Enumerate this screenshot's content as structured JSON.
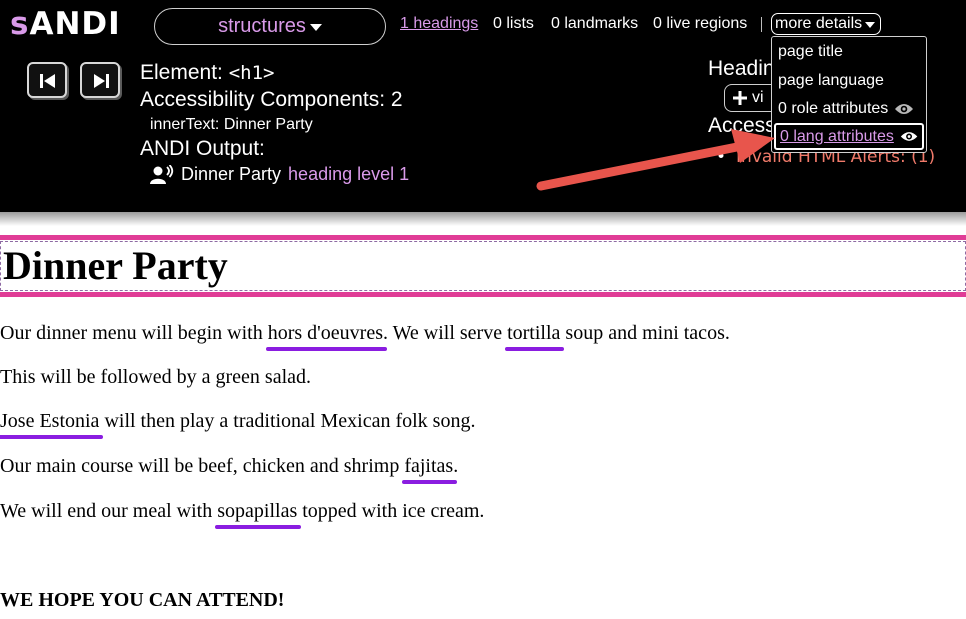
{
  "andi": {
    "logo_prefix": "s",
    "logo_main": "ANDI",
    "module": "structures",
    "top_links": [
      "1 headings",
      "0 lists",
      "0 landmarks",
      "0 live regions"
    ],
    "more_details": "more details",
    "element_label": "Element:",
    "element_tag": "<h1>",
    "components_label": "Accessibility Components: 2",
    "innertext_label": "innerText:",
    "innertext_value": "Dinner Party",
    "output_title": "ANDI Output:",
    "output_text": "Dinner Party",
    "output_level": "heading level 1",
    "right_headings": "Headin",
    "view_button": "vi",
    "right_access": "Access",
    "alert": "Invalid HTML Alerts: (1)",
    "dropdown": [
      "page title",
      "page language",
      "0 role attributes",
      "0 lang attributes"
    ],
    "colors": {
      "accent": "#d99ae9",
      "alert": "#f07a6a",
      "arrow": "#e8554c",
      "highlight": "#e03c96",
      "lang_mark": "#8a1de0"
    }
  },
  "page": {
    "title": "Dinner Party",
    "p1": {
      "a": "Our dinner menu will begin with ",
      "m1": "hors d'oeuvres",
      "b": ". We will serve ",
      "m2": "tortilla",
      "c": " soup and mini tacos."
    },
    "p2": "This will be followed by a green salad.",
    "p3": {
      "m1": "Jose Estonia",
      "a": " will then play a traditional Mexican folk song."
    },
    "p4": {
      "a": "Our main course will be beef, chicken and shrimp ",
      "m1": "fajitas",
      "b": "."
    },
    "p5": {
      "a": "We will end our meal with ",
      "m1": "sopapillas",
      "b": " topped with ice cream."
    },
    "closing": "WE HOPE YOU CAN ATTEND!"
  }
}
